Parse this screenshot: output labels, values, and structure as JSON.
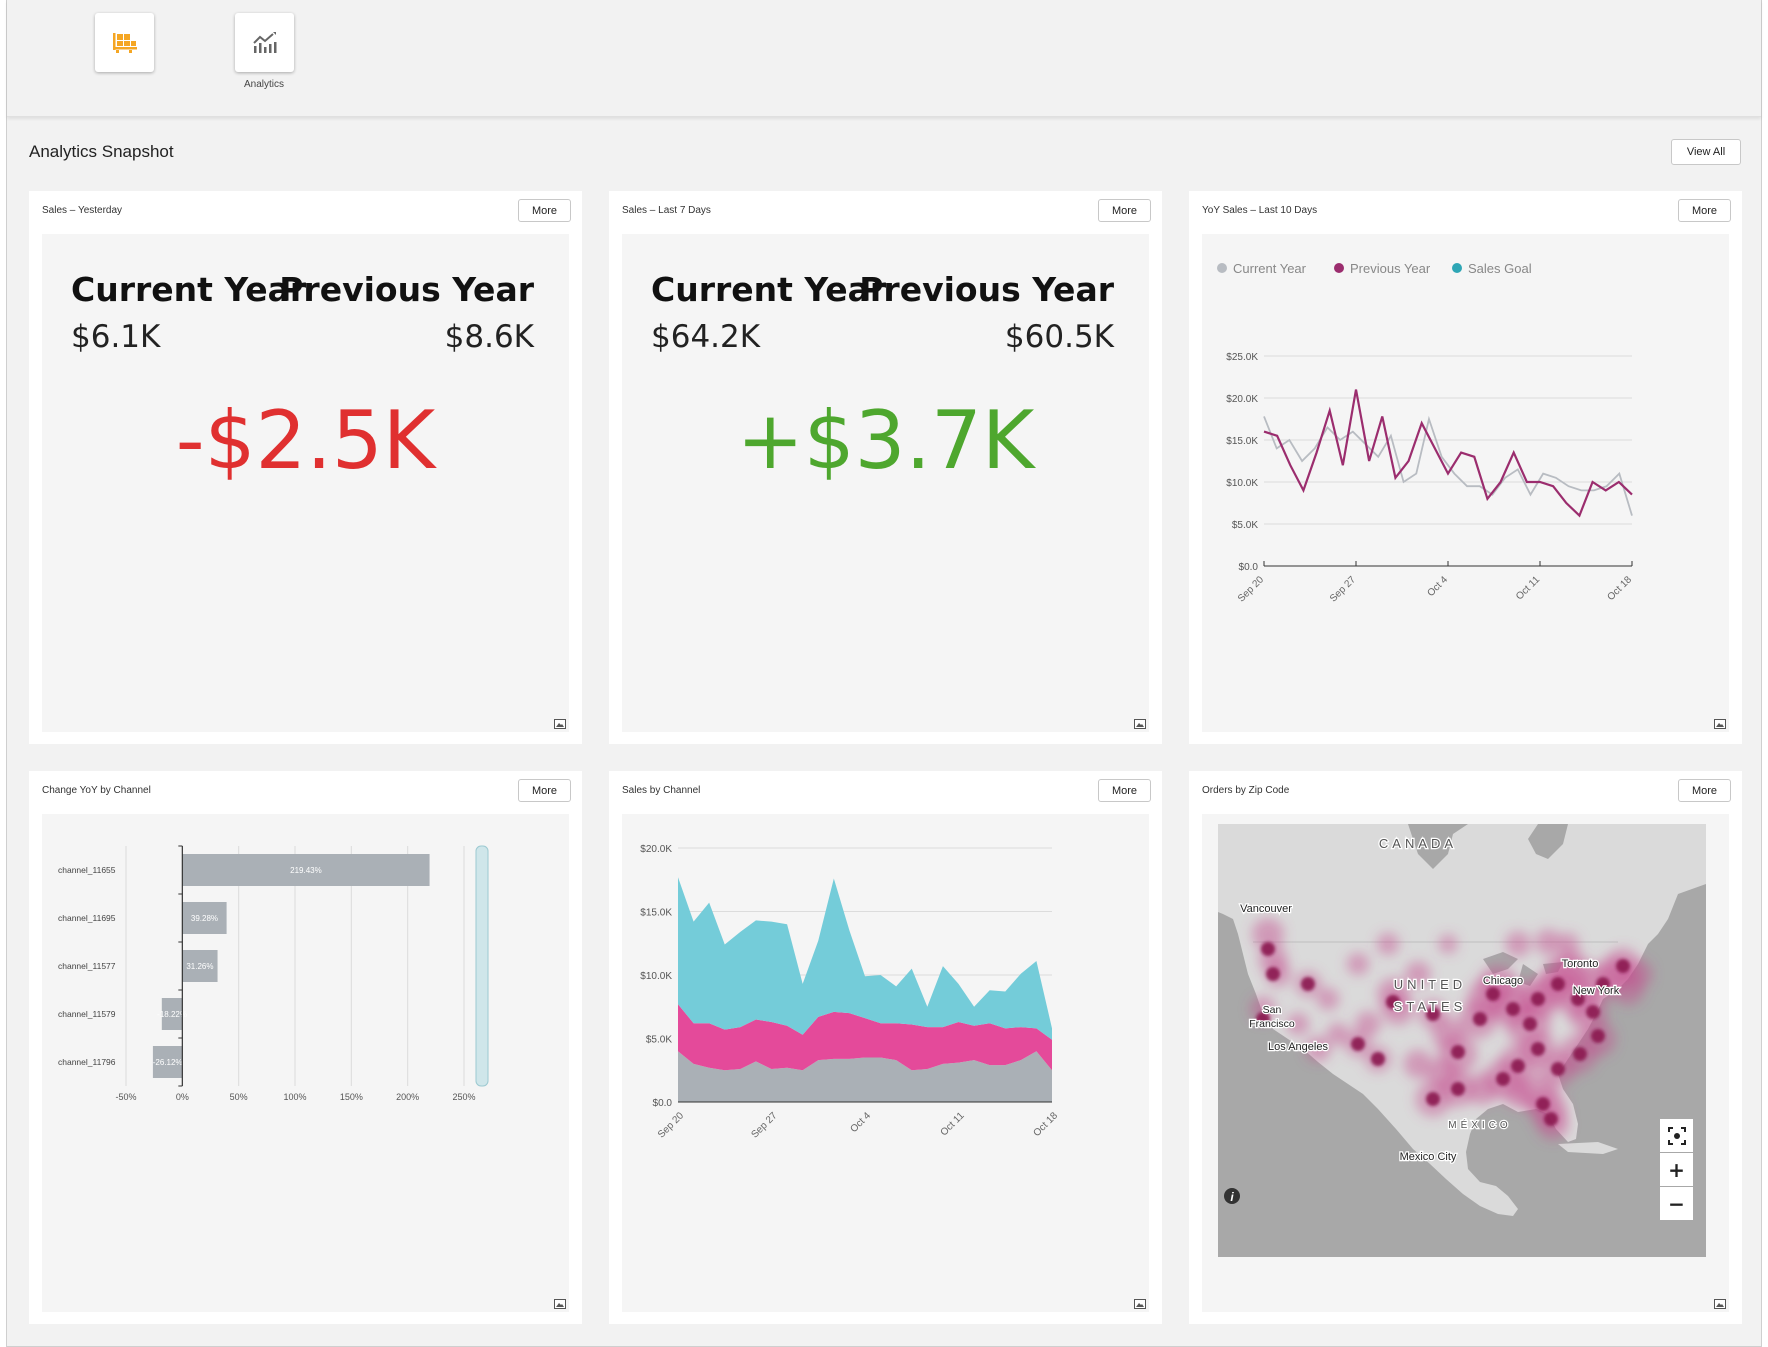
{
  "apps": [
    {
      "label": "",
      "icon": "pallet-icon"
    },
    {
      "label": "Analytics",
      "icon": "analytics-chart-icon"
    }
  ],
  "section": {
    "title": "Analytics Snapshot",
    "view_all": "View All"
  },
  "more_label": "More",
  "cards": {
    "sales_yesterday": {
      "title": "Sales – Yesterday",
      "current_label": "Current Year",
      "previous_label": "Previous Year",
      "current_value": "$6.1K",
      "previous_value": "$8.6K",
      "change": "-$2.5K",
      "change_color": "#e03030"
    },
    "sales_7days": {
      "title": "Sales – Last 7 Days",
      "current_label": "Current Year",
      "previous_label": "Previous Year",
      "current_value": "$64.2K",
      "previous_value": "$60.5K",
      "change": "+$3.7K",
      "change_color": "#4ea72e"
    },
    "yoy_sales": {
      "title": "YoY Sales – Last 10 Days"
    },
    "change_yoy": {
      "title": "Change YoY by Channel"
    },
    "sales_channel": {
      "title": "Sales by Channel"
    },
    "orders_zip": {
      "title": "Orders by Zip Code",
      "map_labels": [
        "CANADA",
        "Vancouver",
        "UNITED",
        "STATES",
        "Chicago",
        "Toronto",
        "New York",
        "San",
        "Francisco",
        "Los Angeles",
        "MÉXICO",
        "Mexico City"
      ],
      "controls": {
        "plus": "+",
        "minus": "−"
      }
    }
  },
  "chart_data": [
    {
      "type": "line",
      "title": "YoY Sales – Last 10 Days",
      "legend": [
        "Current Year",
        "Previous Year",
        "Sales Goal"
      ],
      "legend_placement": "top-left",
      "colors": {
        "Current Year": "#b8bcc2",
        "Previous Year": "#9b2d6e",
        "Sales Goal": "#2ea6b5"
      },
      "y_ticks": [
        "$0.0",
        "$5.0K",
        "$10.0K",
        "$15.0K",
        "$20.0K",
        "$25.0K"
      ],
      "ylim": [
        0,
        25000
      ],
      "x_ticks": [
        "Sep 20",
        "Sep 27",
        "Oct 4",
        "Oct 11",
        "Oct 18"
      ],
      "grid": true,
      "series": [
        {
          "name": "Current Year",
          "values": [
            17800,
            14000,
            15000,
            12500,
            14000,
            16500,
            15000,
            16000,
            14500,
            13000,
            15500,
            10000,
            11000,
            17500,
            13000,
            11000,
            9500,
            9500,
            8500,
            10500,
            11500,
            8500,
            11000,
            10500,
            9500,
            9000,
            9000,
            9500,
            11000,
            6000
          ]
        },
        {
          "name": "Previous Year",
          "values": [
            16000,
            15500,
            12000,
            9000,
            13500,
            18500,
            12000,
            21000,
            12500,
            17800,
            10500,
            12500,
            17000,
            14000,
            11000,
            13500,
            13000,
            8000,
            10000,
            13500,
            10000,
            10000,
            9500,
            7500,
            6000,
            10000,
            9000,
            10000,
            8500
          ]
        }
      ]
    },
    {
      "type": "bar",
      "title": "Change YoY by Channel",
      "orientation": "horizontal",
      "categories": [
        "channel_11655",
        "channel_11695",
        "channel_11577",
        "channel_11579",
        "channel_11796"
      ],
      "values": [
        219.43,
        39.28,
        31.26,
        -18.22,
        -26.12
      ],
      "labels": [
        "219.43%",
        "39.28%",
        "31.26%",
        "-18.22%",
        "-26.12%"
      ],
      "x_ticks": [
        "-50%",
        "0%",
        "50%",
        "100%",
        "150%",
        "200%",
        "250%"
      ],
      "xlim": [
        -50,
        250
      ],
      "grid": true,
      "bar_color": "#aab0b6"
    },
    {
      "type": "area",
      "title": "Sales by Channel",
      "stacked": true,
      "y_ticks": [
        "$0.0",
        "$5.0K",
        "$10.0K",
        "$15.0K",
        "$20.0K"
      ],
      "ylim": [
        0,
        20000
      ],
      "x_ticks": [
        "Sep 20",
        "Sep 27",
        "Oct 4",
        "Oct 11",
        "Oct 18"
      ],
      "grid": true,
      "series": [
        {
          "color": "#aab0b6",
          "values": [
            4000,
            3000,
            2700,
            2500,
            2600,
            3200,
            2600,
            2700,
            2500,
            3300,
            3400,
            3400,
            3500,
            3500,
            3300,
            2500,
            2600,
            3000,
            3100,
            3300,
            2900,
            2900,
            3300,
            4000,
            2500
          ]
        },
        {
          "color": "#e44a9a",
          "values": [
            3700,
            3200,
            3500,
            3200,
            3300,
            3300,
            3700,
            3300,
            2800,
            3400,
            3700,
            3600,
            3100,
            2700,
            2900,
            3600,
            3300,
            2900,
            3200,
            2700,
            3300,
            2900,
            2600,
            1800,
            2400
          ]
        },
        {
          "color": "#74ccd9",
          "values": [
            10000,
            8000,
            9500,
            6700,
            7500,
            7800,
            7900,
            8000,
            4000,
            6000,
            10500,
            6500,
            3300,
            3800,
            2900,
            4400,
            1600,
            4800,
            3000,
            1500,
            2600,
            2900,
            4200,
            5300,
            900
          ]
        }
      ]
    }
  ]
}
